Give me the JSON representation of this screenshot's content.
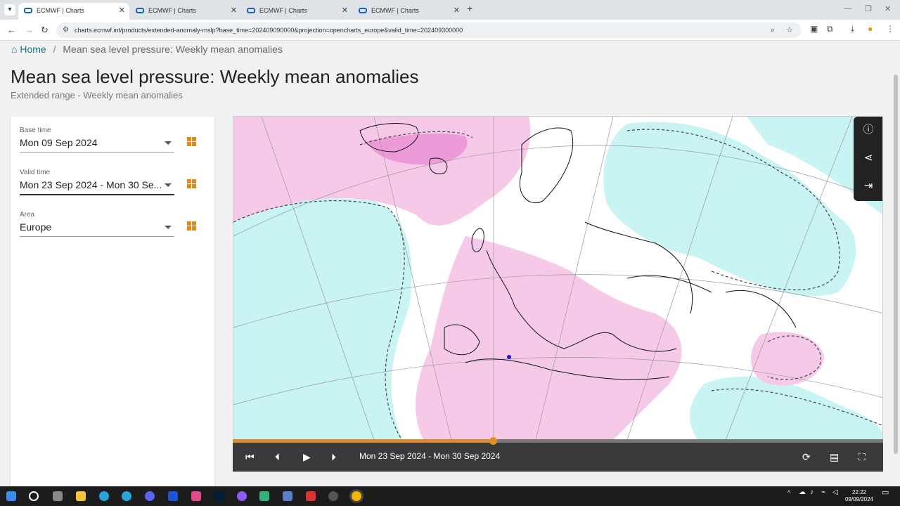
{
  "browser": {
    "tabs": [
      {
        "label": "ECMWF | Charts",
        "active": true
      },
      {
        "label": "ECMWF | Charts",
        "active": false
      },
      {
        "label": "ECMWF | Charts",
        "active": false
      },
      {
        "label": "ECMWF | Charts",
        "active": false
      }
    ],
    "url": "charts.ecmwf.int/products/extended-anomaly-mslp?base_time=202409090000&projection=opencharts_europe&valid_time=202409300000"
  },
  "breadcrumb": {
    "home": "Home",
    "current": "Mean sea level pressure: Weekly mean anomalies"
  },
  "page": {
    "title": "Mean sea level pressure: Weekly mean anomalies",
    "subtitle": "Extended range - Weekly mean anomalies"
  },
  "controls": {
    "base_time": {
      "label": "Base time",
      "value": "Mon 09 Sep 2024"
    },
    "valid_time": {
      "label": "Valid time",
      "value": "Mon 23 Sep 2024 - Mon 30 Se..."
    },
    "area": {
      "label": "Area",
      "value": "Europe"
    }
  },
  "player": {
    "period": "Mon 23 Sep 2024 - Mon 30 Sep 2024",
    "progress": 0.4
  },
  "taskbar": {
    "time": "22:22",
    "date": "09/09/2024"
  },
  "colors": {
    "positive_anomaly": "#f7c9e8",
    "negative_anomaly": "#c9f4f4",
    "accent": "#e08a1e",
    "home_link": "#137a8a"
  }
}
